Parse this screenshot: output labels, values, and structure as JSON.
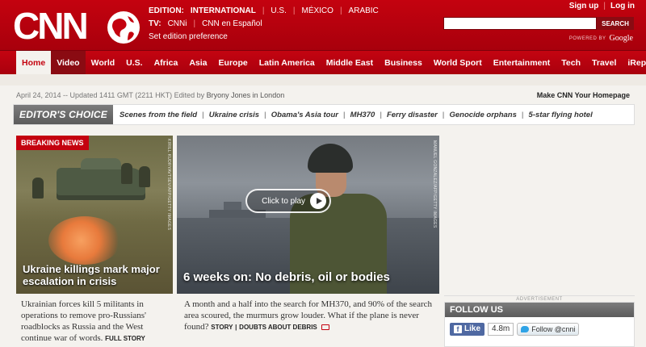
{
  "header": {
    "edition_label": "EDITION:",
    "edition_current": "INTERNATIONAL",
    "editions": [
      "U.S.",
      "MÉXICO",
      "ARABIC"
    ],
    "tv_label": "TV:",
    "tv_channels": [
      "CNNi",
      "CNN en Español"
    ],
    "set_pref": "Set edition preference",
    "sign_up": "Sign up",
    "log_in": "Log in",
    "search_placeholder": "",
    "search_button": "SEARCH",
    "powered_by": "POWERED BY",
    "powered_brand": "Google",
    "colors": {
      "brand_red": "#c4020f"
    }
  },
  "nav": [
    "Home",
    "Video",
    "World",
    "U.S.",
    "Africa",
    "Asia",
    "Europe",
    "Latin America",
    "Middle East",
    "Business",
    "World Sport",
    "Entertainment",
    "Tech",
    "Travel",
    "iReport"
  ],
  "dateline": {
    "text": "April 24, 2014 -- Updated 1411 GMT (2211 HKT) Edited by",
    "editor": "Bryony Jones in London"
  },
  "make_homepage": "Make CNN Your Homepage",
  "editors_choice": {
    "label": "EDITOR'S CHOICE",
    "links": [
      "Scenes from the field",
      "Ukraine crisis",
      "Obama's Asia tour",
      "MH370",
      "Ferry disaster",
      "Genocide orphans",
      "5-star flying hotel"
    ]
  },
  "story_left": {
    "badge": "BREAKING NEWS",
    "photo_credit": "KIRILL KUDRYAVTSEV/AFP/GETTY IMAGES",
    "headline": "Ukraine killings mark major escalation in crisis",
    "summary": "Ukrainian forces kill 5 militants in operations to remove pro-Russians' roadblocks as Russia and the West continue war of words.",
    "link": "FULL STORY"
  },
  "story_main": {
    "play_label": "Click to play",
    "photo_credit": "MANUEL GONZALEZ/AFP/GETTY IMAGES",
    "headline": "6 weeks on: No debris, oil or bodies",
    "summary": "A month and a half into the search for MH370, and 90% of the search area scoured, the murmurs grow louder. What if the plane is never found?",
    "link_story": "STORY",
    "link_sep": "|",
    "link_doubts": "DOUBTS ABOUT DEBRIS"
  },
  "sidebar": {
    "advertisement": "ADVERTISEMENT",
    "follow_title": "FOLLOW US",
    "like_label": "Like",
    "like_count": "4.8m",
    "twitter_label": "Follow @cnni"
  }
}
